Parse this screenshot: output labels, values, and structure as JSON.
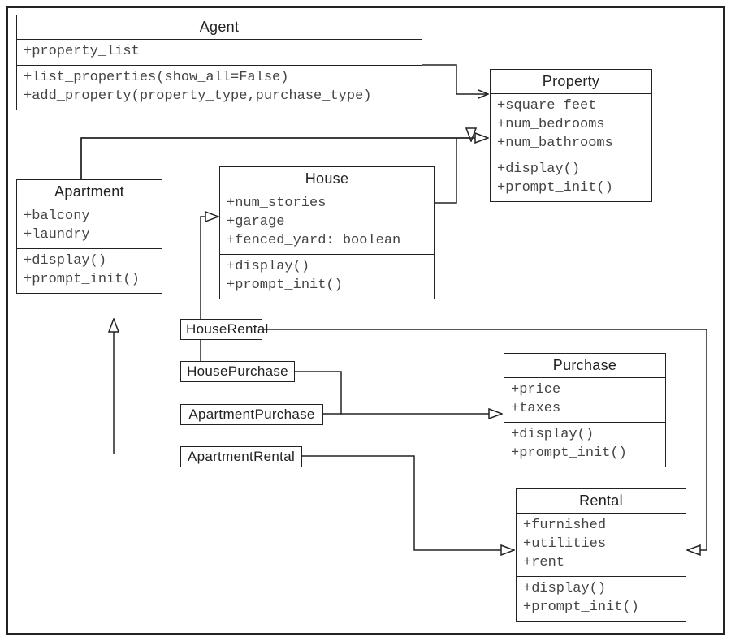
{
  "diagram": {
    "type": "uml-class-diagram",
    "classes": {
      "Agent": {
        "name": "Agent",
        "attributes": [
          "+property_list"
        ],
        "methods": [
          "+list_properties(show_all=False)",
          "+add_property(property_type,purchase_type)"
        ]
      },
      "Property": {
        "name": "Property",
        "attributes": [
          "+square_feet",
          "+num_bedrooms",
          "+num_bathrooms"
        ],
        "methods": [
          "+display()",
          "+prompt_init()"
        ]
      },
      "Apartment": {
        "name": "Apartment",
        "attributes": [
          "+balcony",
          "+laundry"
        ],
        "methods": [
          "+display()",
          "+prompt_init()"
        ]
      },
      "House": {
        "name": "House",
        "attributes": [
          "+num_stories",
          "+garage",
          "+fenced_yard: boolean"
        ],
        "methods": [
          "+display()",
          "+prompt_init()"
        ]
      },
      "Purchase": {
        "name": "Purchase",
        "attributes": [
          "+price",
          "+taxes"
        ],
        "methods": [
          "+display()",
          "+prompt_init()"
        ]
      },
      "Rental": {
        "name": "Rental",
        "attributes": [
          "+furnished",
          "+utilities",
          "+rent"
        ],
        "methods": [
          "+display()",
          "+prompt_init()"
        ]
      },
      "HouseRental": {
        "name": "HouseRental"
      },
      "HousePurchase": {
        "name": "HousePurchase"
      },
      "ApartmentPurchase": {
        "name": "ApartmentPurchase"
      },
      "ApartmentRental": {
        "name": "ApartmentRental"
      }
    },
    "relationships": [
      {
        "from": "Agent",
        "to": "Property",
        "type": "association"
      },
      {
        "from": "Apartment",
        "to": "Property",
        "type": "generalization"
      },
      {
        "from": "House",
        "to": "Property",
        "type": "generalization"
      },
      {
        "from": "HouseRental",
        "to": "House",
        "type": "generalization"
      },
      {
        "from": "HouseRental",
        "to": "Rental",
        "type": "generalization"
      },
      {
        "from": "HousePurchase",
        "to": "House",
        "type": "generalization"
      },
      {
        "from": "HousePurchase",
        "to": "Purchase",
        "type": "generalization"
      },
      {
        "from": "ApartmentPurchase",
        "to": "Apartment",
        "type": "generalization"
      },
      {
        "from": "ApartmentPurchase",
        "to": "Purchase",
        "type": "generalization"
      },
      {
        "from": "ApartmentRental",
        "to": "Apartment",
        "type": "generalization"
      },
      {
        "from": "ApartmentRental",
        "to": "Rental",
        "type": "generalization"
      }
    ]
  }
}
